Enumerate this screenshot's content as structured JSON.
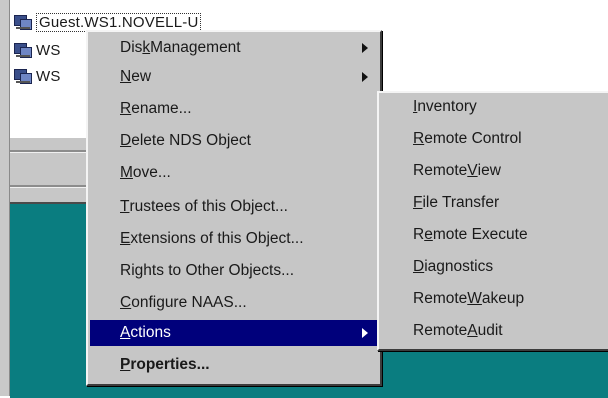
{
  "tree": {
    "items": [
      {
        "label": "Guest.WS1.NOVELL-U"
      },
      {
        "label": "WS"
      },
      {
        "label": "WS"
      }
    ],
    "clipped_text": "23"
  },
  "context_menu": {
    "items": [
      {
        "pre": "Dis",
        "ul": "k",
        "post": " Management",
        "submenu": true
      },
      {
        "pre": "",
        "ul": "N",
        "post": "ew",
        "submenu": true
      },
      {
        "pre": "",
        "ul": "R",
        "post": "ename...",
        "submenu": false
      },
      {
        "pre": "",
        "ul": "D",
        "post": "elete NDS Object",
        "submenu": false
      },
      {
        "pre": "",
        "ul": "M",
        "post": "ove...",
        "submenu": false
      },
      {
        "pre": "",
        "ul": "T",
        "post": "rustees of this Object...",
        "submenu": false
      },
      {
        "pre": "",
        "ul": "E",
        "post": "xtensions of this Object...",
        "submenu": false
      },
      {
        "pre": "Ri",
        "ul": "g",
        "post": "hts to Other Objects...",
        "submenu": false
      },
      {
        "pre": "",
        "ul": "C",
        "post": "onfigure NAAS...",
        "submenu": false
      },
      {
        "pre": "",
        "ul": "A",
        "post": "ctions",
        "submenu": true,
        "selected": true
      },
      {
        "pre": "",
        "ul": "P",
        "post": "roperties...",
        "submenu": false,
        "bold": true
      }
    ]
  },
  "actions_submenu": {
    "items": [
      {
        "pre": "",
        "ul": "I",
        "post": "nventory"
      },
      {
        "pre": "",
        "ul": "R",
        "post": "emote Control"
      },
      {
        "pre": "Remote ",
        "ul": "V",
        "post": "iew"
      },
      {
        "pre": "",
        "ul": "F",
        "post": "ile Transfer"
      },
      {
        "pre": "R",
        "ul": "e",
        "post": "mote Execute"
      },
      {
        "pre": "",
        "ul": "D",
        "post": "iagnostics"
      },
      {
        "pre": "Remote ",
        "ul": "W",
        "post": "akeup"
      },
      {
        "pre": "Remote ",
        "ul": "A",
        "post": "udit"
      }
    ]
  },
  "colors": {
    "menu_bg": "#c6c6c6",
    "selection": "#00007b",
    "desktop": "#0a7d80"
  }
}
